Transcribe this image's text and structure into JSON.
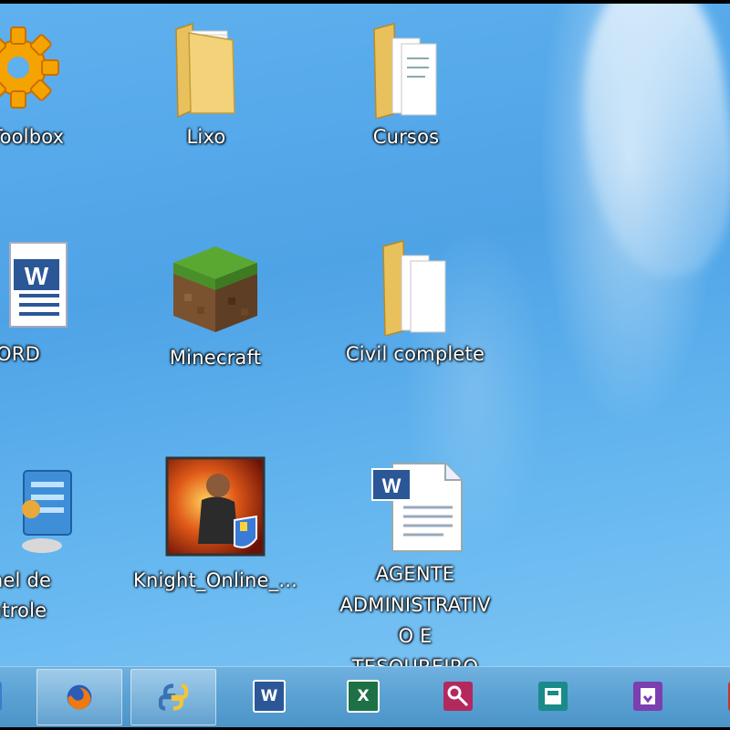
{
  "desktop": {
    "icons": [
      {
        "label": "S Toolbox",
        "icon": "gear-icon"
      },
      {
        "label": "Lixo",
        "icon": "folder-icon"
      },
      {
        "label": "Cursos",
        "icon": "folder-icon"
      },
      {
        "label": "ORD",
        "icon": "word-document-icon"
      },
      {
        "label": "Minecraft",
        "icon": "minecraft-block-icon"
      },
      {
        "label": "Civil complete",
        "icon": "folder-icon"
      },
      {
        "label": "inel de\nntrole",
        "icon": "control-panel-icon"
      },
      {
        "label": "Knight_Online_...",
        "icon": "knight-online-icon"
      },
      {
        "label": "AGENTE\nADMINISTRATIV\nO E TESOUREIRO",
        "icon": "word-document-icon"
      }
    ]
  },
  "taskbar": {
    "buttons": [
      {
        "icon": "start-edge-icon"
      },
      {
        "icon": "firefox-icon"
      },
      {
        "icon": "python-icon"
      },
      {
        "icon": "word-icon",
        "text": "W"
      },
      {
        "icon": "excel-icon",
        "text": "X"
      },
      {
        "icon": "access-icon"
      },
      {
        "icon": "publisher-icon"
      },
      {
        "icon": "onenote-icon"
      },
      {
        "icon": "powerpoint-icon"
      }
    ]
  },
  "colors": {
    "desktop_blue": "#4ea3e6",
    "taskbar_blue": "#5aa1d3",
    "word_blue": "#2b5797",
    "excel_green": "#1e7145",
    "folder_yellow": "#f3d27a"
  }
}
